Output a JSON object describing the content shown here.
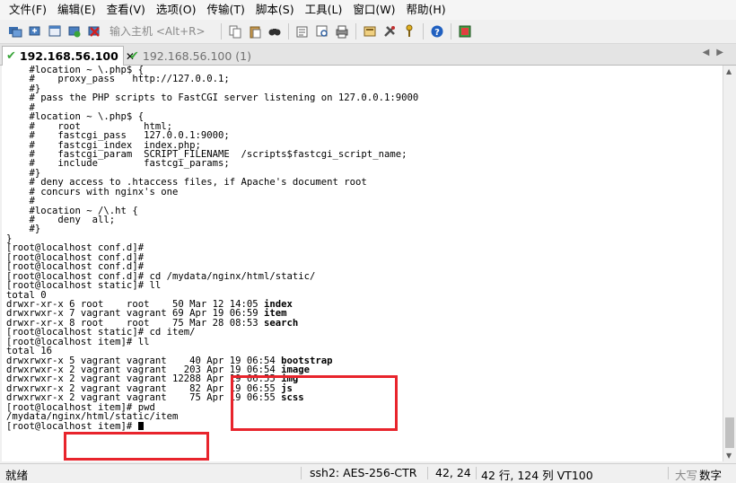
{
  "menubar": {
    "items": [
      "文件(F)",
      "编辑(E)",
      "查看(V)",
      "选项(O)",
      "传输(T)",
      "脚本(S)",
      "工具(L)",
      "窗口(W)",
      "帮助(H)"
    ]
  },
  "toolbar": {
    "host_placeholder": "输入主机 <Alt+R>"
  },
  "tabs": [
    {
      "label": "192.168.56.100",
      "active": true
    },
    {
      "label": "192.168.56.100 (1)",
      "active": false
    }
  ],
  "terminal": {
    "lines": [
      "    #location ~ \\.php$ {",
      "    #    proxy_pass   http://127.0.0.1;",
      "    #}",
      "",
      "    # pass the PHP scripts to FastCGI server listening on 127.0.0.1:9000",
      "    #",
      "    #location ~ \\.php$ {",
      "    #    root           html;",
      "    #    fastcgi_pass   127.0.0.1:9000;",
      "    #    fastcgi_index  index.php;",
      "    #    fastcgi_param  SCRIPT_FILENAME  /scripts$fastcgi_script_name;",
      "    #    include        fastcgi_params;",
      "    #}",
      "",
      "    # deny access to .htaccess files, if Apache's document root",
      "    # concurs with nginx's one",
      "    #",
      "    #location ~ /\\.ht {",
      "    #    deny  all;",
      "    #}",
      "}",
      "",
      "[root@localhost conf.d]#",
      "[root@localhost conf.d]#",
      "[root@localhost conf.d]#",
      "[root@localhost conf.d]# cd /mydata/nginx/html/static/",
      "[root@localhost static]# ll",
      "total 0"
    ],
    "listing1": [
      {
        "meta": "drwxr-xr-x 6 root    root    50 Mar 12 14:05 ",
        "name": "index"
      },
      {
        "meta": "drwxrwxr-x 7 vagrant vagrant 69 Apr 19 06:59 ",
        "name": "item"
      },
      {
        "meta": "drwxr-xr-x 8 root    root    75 Mar 28 08:53 ",
        "name": "search"
      }
    ],
    "lines2": [
      "[root@localhost static]# cd item/",
      "[root@localhost item]# ll",
      "total 16"
    ],
    "listing2": [
      {
        "meta": "drwxrwxr-x 5 vagrant vagrant    40 Apr 19 06:54 ",
        "name": "bootstrap"
      },
      {
        "meta": "drwxrwxr-x 2 vagrant vagrant   203 Apr 19 06:54 ",
        "name": "image"
      },
      {
        "meta": "drwxrwxr-x 2 vagrant vagrant 12288 Apr 19 06:55 ",
        "name": "img"
      },
      {
        "meta": "drwxrwxr-x 2 vagrant vagrant    82 Apr 19 06:55 ",
        "name": "js"
      },
      {
        "meta": "drwxrwxr-x 2 vagrant vagrant    75 Apr 19 06:55 ",
        "name": "scss"
      }
    ],
    "lines3": [
      "[root@localhost item]# pwd",
      "/mydata/nginx/html/static/item"
    ],
    "prompt": "[root@localhost item]# "
  },
  "statusbar": {
    "ready": "就绪",
    "ssh": "ssh2: AES-256-CTR",
    "cursor_pos": "42,  24",
    "lines_info": "42 行, 124 列  VT100",
    "caps": "大写",
    "num": "数字"
  },
  "colors": {
    "highlight": "#e8242c",
    "tab_check": "#3aa53a"
  }
}
